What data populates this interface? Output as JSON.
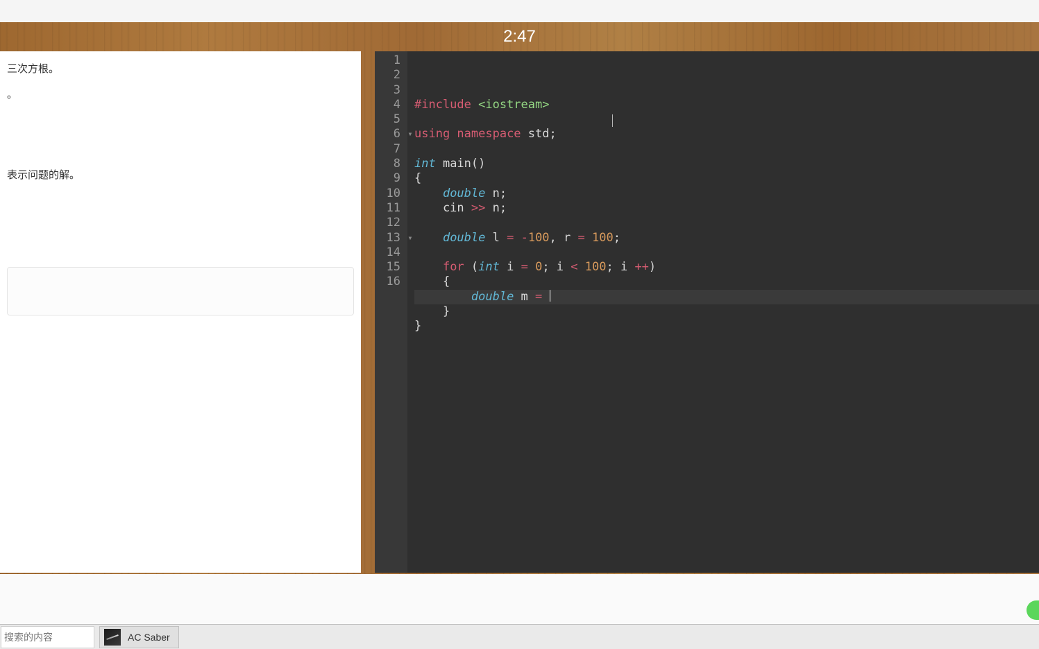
{
  "timer": "2:47",
  "problem": {
    "line1": "三次方根。",
    "line1_full": "。",
    "line2": "表示问题的解。"
  },
  "code": {
    "lines": [
      {
        "n": 1,
        "fold": "",
        "tokens": [
          {
            "t": "#include ",
            "c": "preproc"
          },
          {
            "t": "<iostream>",
            "c": "include"
          }
        ]
      },
      {
        "n": 2,
        "fold": "",
        "tokens": []
      },
      {
        "n": 3,
        "fold": "",
        "tokens": [
          {
            "t": "using ",
            "c": "using"
          },
          {
            "t": "namespace ",
            "c": "using"
          },
          {
            "t": "std",
            "c": "var"
          },
          {
            "t": ";",
            "c": "punc"
          }
        ]
      },
      {
        "n": 4,
        "fold": "",
        "tokens": []
      },
      {
        "n": 5,
        "fold": "",
        "tokens": [
          {
            "t": "int ",
            "c": "type"
          },
          {
            "t": "main",
            "c": "func"
          },
          {
            "t": "()",
            "c": "punc"
          }
        ]
      },
      {
        "n": 6,
        "fold": "▾",
        "tokens": [
          {
            "t": "{",
            "c": "punc"
          }
        ]
      },
      {
        "n": 7,
        "fold": "",
        "tokens": [
          {
            "t": "    ",
            "c": ""
          },
          {
            "t": "double ",
            "c": "type"
          },
          {
            "t": "n",
            "c": "var"
          },
          {
            "t": ";",
            "c": "punc"
          }
        ]
      },
      {
        "n": 8,
        "fold": "",
        "tokens": [
          {
            "t": "    cin ",
            "c": "var"
          },
          {
            "t": ">> ",
            "c": "op"
          },
          {
            "t": "n",
            "c": "var"
          },
          {
            "t": ";",
            "c": "punc"
          }
        ]
      },
      {
        "n": 9,
        "fold": "",
        "tokens": []
      },
      {
        "n": 10,
        "fold": "",
        "tokens": [
          {
            "t": "    ",
            "c": ""
          },
          {
            "t": "double ",
            "c": "type"
          },
          {
            "t": "l ",
            "c": "var"
          },
          {
            "t": "= ",
            "c": "op"
          },
          {
            "t": "-",
            "c": "op"
          },
          {
            "t": "100",
            "c": "num"
          },
          {
            "t": ", r ",
            "c": "var"
          },
          {
            "t": "= ",
            "c": "op"
          },
          {
            "t": "100",
            "c": "num"
          },
          {
            "t": ";",
            "c": "punc"
          }
        ]
      },
      {
        "n": 11,
        "fold": "",
        "tokens": []
      },
      {
        "n": 12,
        "fold": "",
        "tokens": [
          {
            "t": "    ",
            "c": ""
          },
          {
            "t": "for ",
            "c": "keyword"
          },
          {
            "t": "(",
            "c": "punc"
          },
          {
            "t": "int ",
            "c": "type"
          },
          {
            "t": "i ",
            "c": "var"
          },
          {
            "t": "= ",
            "c": "op"
          },
          {
            "t": "0",
            "c": "num"
          },
          {
            "t": "; i ",
            "c": "var"
          },
          {
            "t": "< ",
            "c": "op"
          },
          {
            "t": "100",
            "c": "num"
          },
          {
            "t": "; i ",
            "c": "var"
          },
          {
            "t": "++",
            "c": "op"
          },
          {
            "t": ")",
            "c": "punc"
          }
        ]
      },
      {
        "n": 13,
        "fold": "▾",
        "tokens": [
          {
            "t": "    {",
            "c": "punc"
          }
        ]
      },
      {
        "n": 14,
        "fold": "",
        "active": true,
        "tokens": [
          {
            "t": "        ",
            "c": ""
          },
          {
            "t": "double ",
            "c": "type"
          },
          {
            "t": "m ",
            "c": "var"
          },
          {
            "t": "= ",
            "c": "op"
          }
        ],
        "cursor": true
      },
      {
        "n": 15,
        "fold": "",
        "tokens": [
          {
            "t": "    }",
            "c": "punc"
          }
        ]
      },
      {
        "n": 16,
        "fold": "",
        "tokens": [
          {
            "t": "}",
            "c": "punc"
          }
        ]
      }
    ]
  },
  "taskbar": {
    "search_placeholder": "搜索的内容",
    "app_name": "AC Saber"
  }
}
